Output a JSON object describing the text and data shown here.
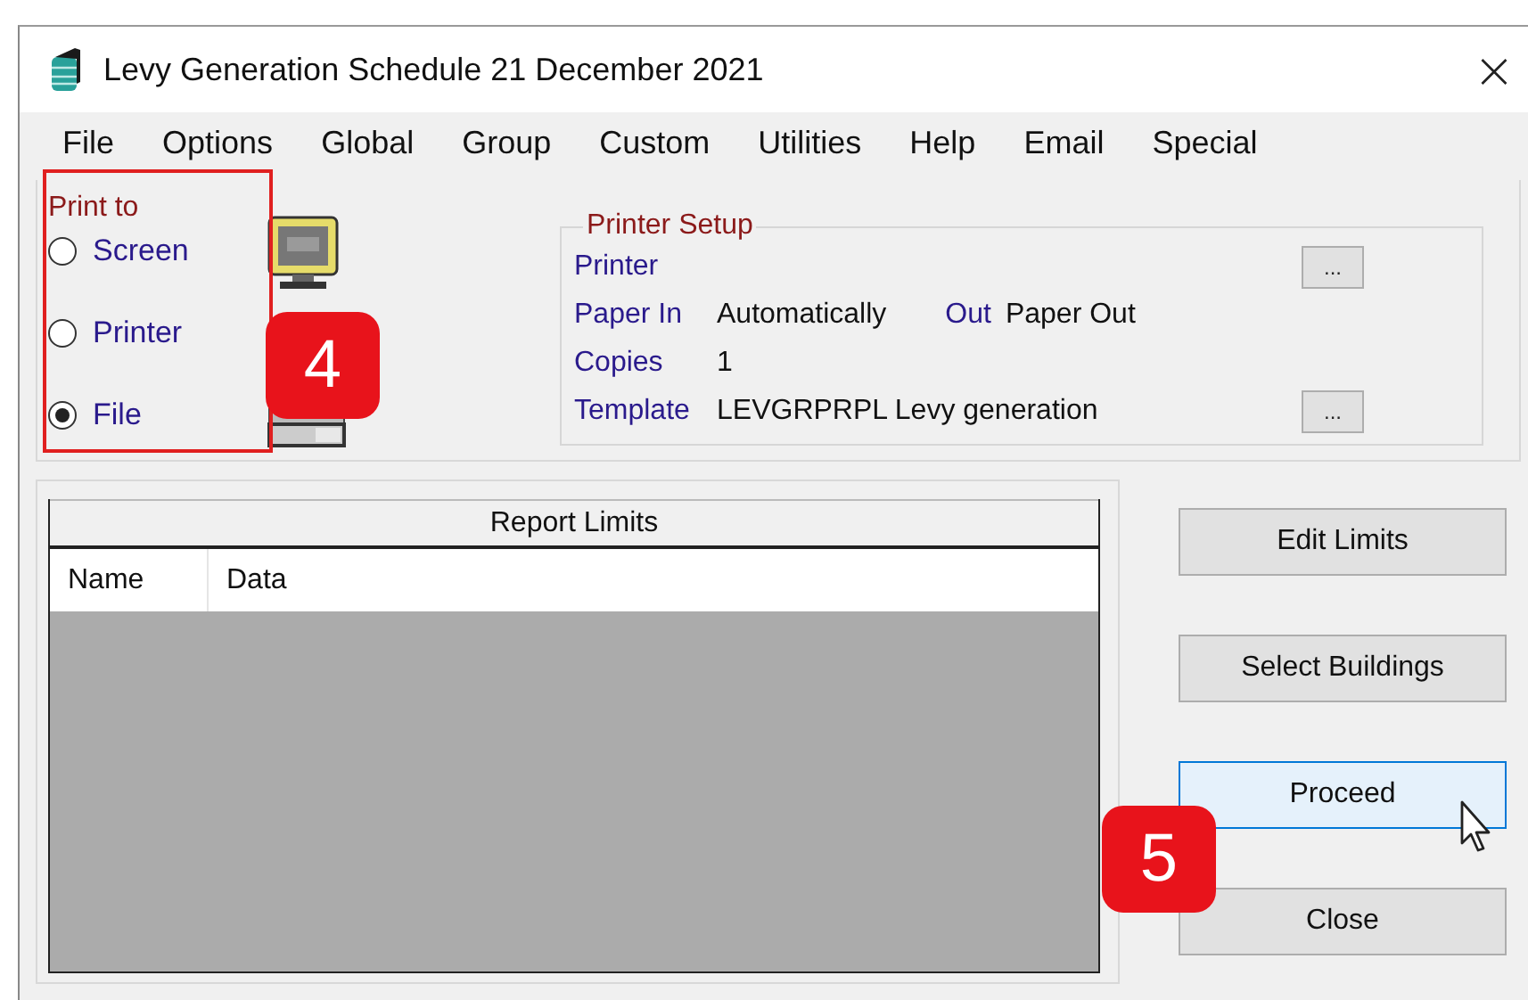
{
  "window": {
    "title": "Levy Generation Schedule 21 December 2021",
    "close": "×"
  },
  "menu": [
    "File",
    "Options",
    "Global",
    "Group",
    "Custom",
    "Utilities",
    "Help",
    "Email",
    "Special"
  ],
  "print_to": {
    "label": "Print to",
    "options": [
      {
        "label": "Screen",
        "selected": false
      },
      {
        "label": "Printer",
        "selected": false
      },
      {
        "label": "File",
        "selected": true
      }
    ]
  },
  "printer_setup": {
    "title": "Printer Setup",
    "rows": [
      {
        "label": "Printer",
        "button": "..."
      },
      {
        "label": "Paper In",
        "value": "Automatically",
        "out_label": "Out",
        "out_value": "Paper Out"
      },
      {
        "label": "Copies",
        "value": "1"
      },
      {
        "label": "Template",
        "value": "LEVGRPRPL Levy generation",
        "button": "..."
      }
    ]
  },
  "report_limits": {
    "title": "Report Limits",
    "columns": [
      "Name",
      "Data"
    ]
  },
  "buttons": [
    {
      "label": "Edit Limits",
      "focused": false
    },
    {
      "label": "Select Buildings",
      "focused": false
    },
    {
      "label": "Proceed",
      "focused": true
    },
    {
      "label": "Close",
      "focused": false
    }
  ],
  "annotations": [
    {
      "label": "4"
    },
    {
      "label": "5"
    }
  ]
}
